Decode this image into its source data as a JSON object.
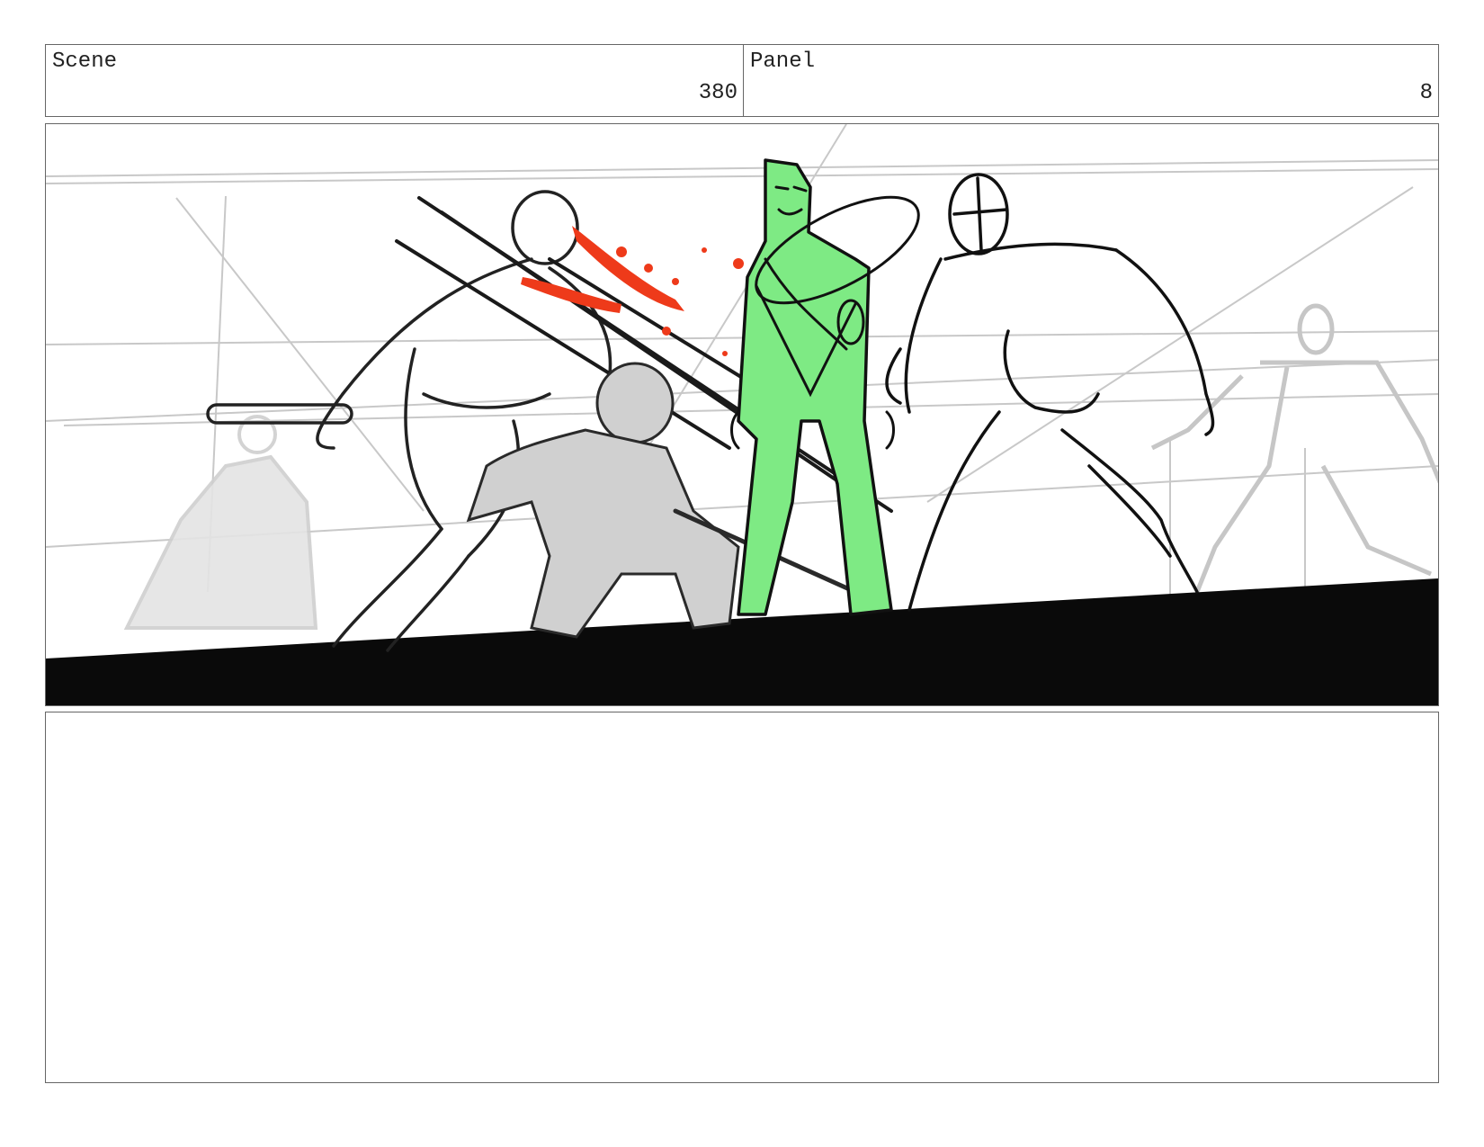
{
  "header": {
    "scene_label": "Scene",
    "scene_number": "380",
    "panel_label": "Panel",
    "panel_number": "8"
  },
  "artwork": {
    "accent_green": "#7eea84",
    "blood_red": "#ee3a1a",
    "ink": "#111111",
    "rough_gray": "#bdbdbd"
  },
  "notes": {
    "text": ""
  }
}
